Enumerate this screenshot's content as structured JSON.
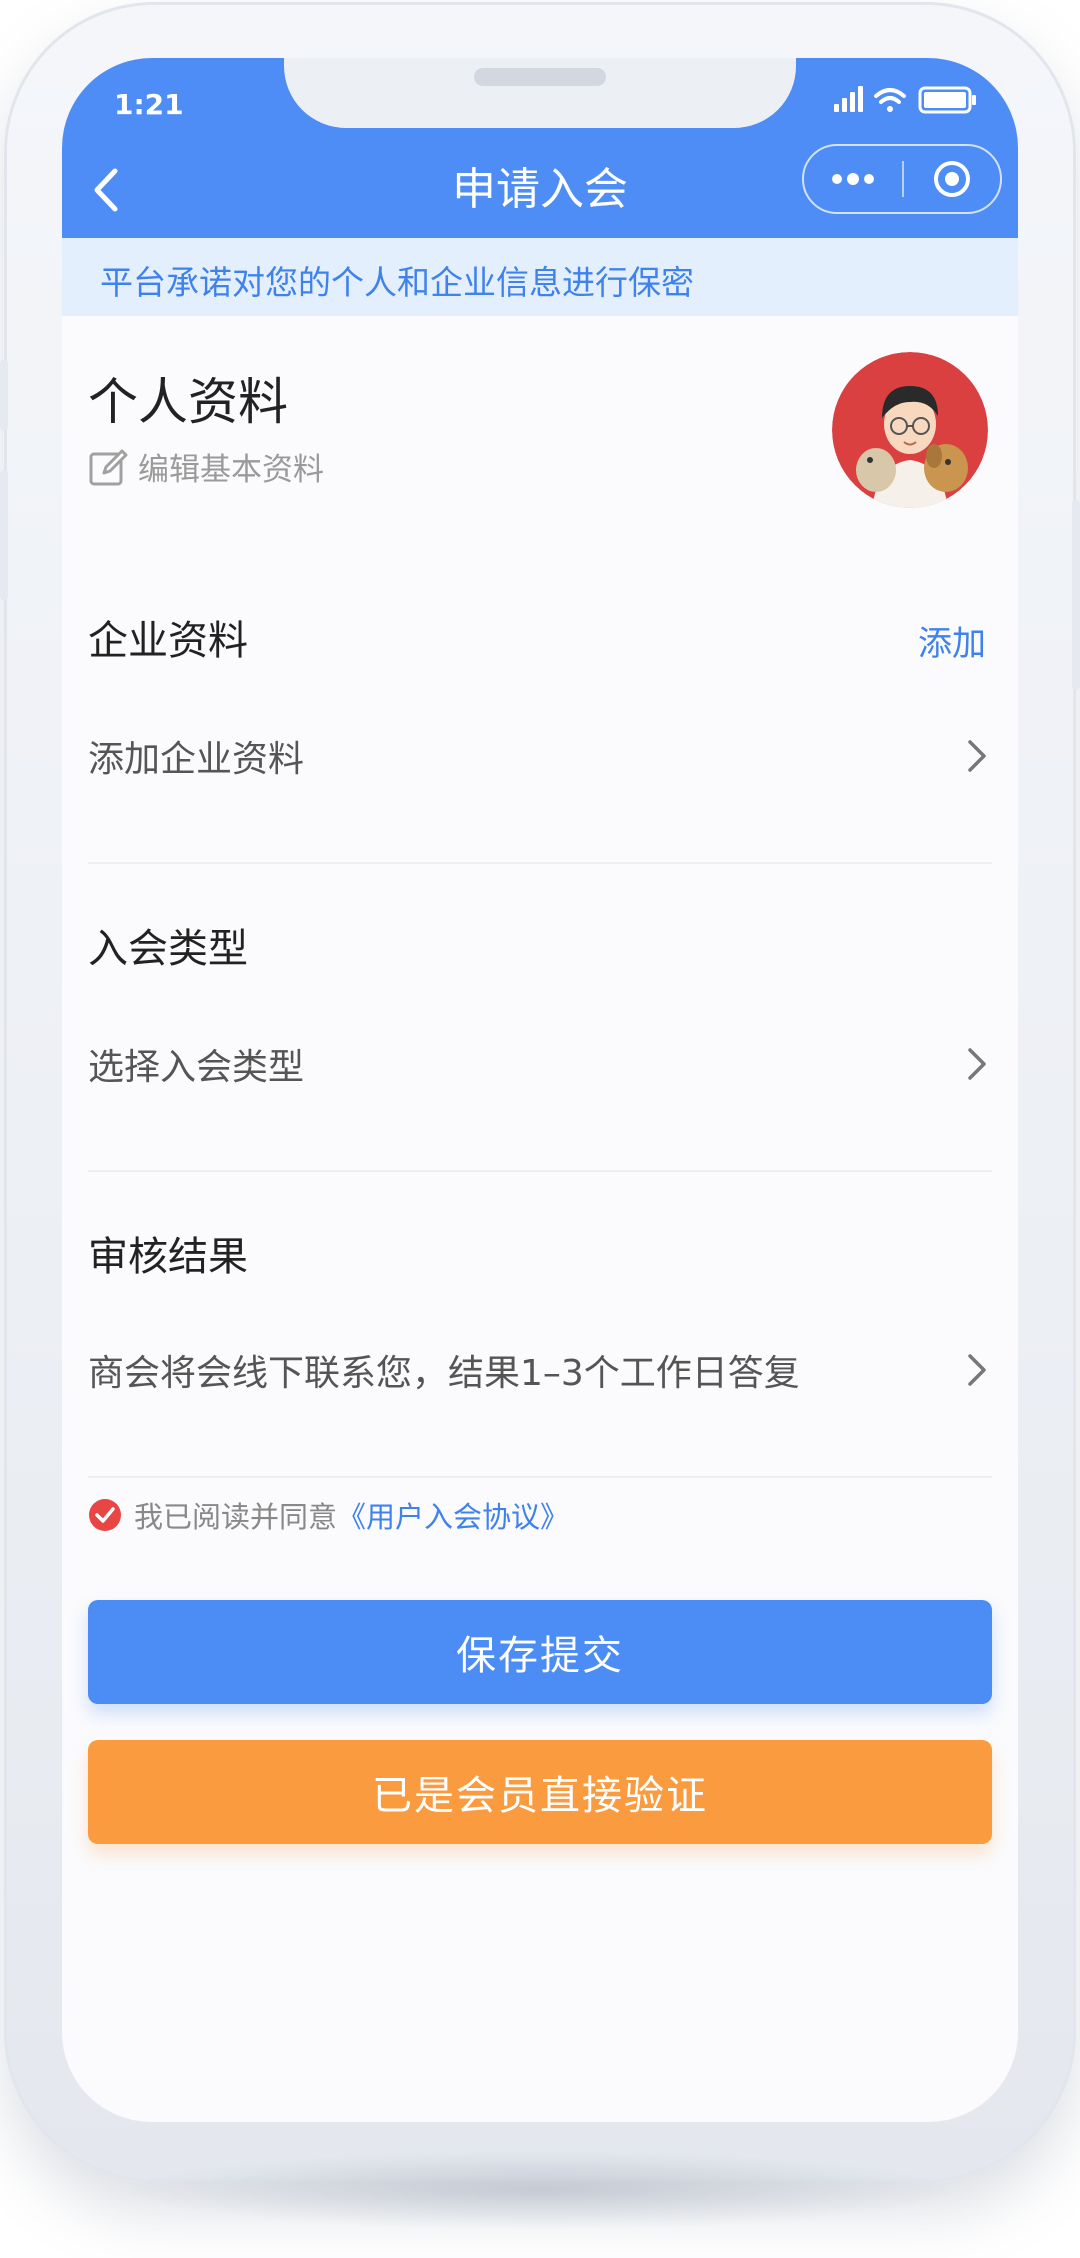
{
  "status_bar": {
    "time": "1:21"
  },
  "nav": {
    "title": "申请入会"
  },
  "notice": {
    "text": "平台承诺对您的个人和企业信息进行保密"
  },
  "profile": {
    "title": "个人资料",
    "edit_label": "编辑基本资料"
  },
  "company": {
    "title": "企业资料",
    "add_label": "添加",
    "row_label": "添加企业资料"
  },
  "membership": {
    "title": "入会类型",
    "row_label": "选择入会类型"
  },
  "review": {
    "title": "审核结果",
    "row_label": "商会将会线下联系您，结果1–3个工作日答复"
  },
  "agreement": {
    "prefix": "我已阅读并同意",
    "link": "《用户入会协议》",
    "checked": true
  },
  "buttons": {
    "submit": "保存提交",
    "verify": "已是会员直接验证"
  },
  "colors": {
    "primary": "#4b8cf5",
    "orange": "#fb9b40",
    "notice_bg": "#e4effd",
    "check": "#e94545"
  },
  "icons": [
    "back-icon",
    "more-icon",
    "home-icon",
    "edit-icon",
    "chevron-right-icon",
    "check-icon",
    "signal-icon",
    "wifi-icon",
    "battery-icon"
  ]
}
